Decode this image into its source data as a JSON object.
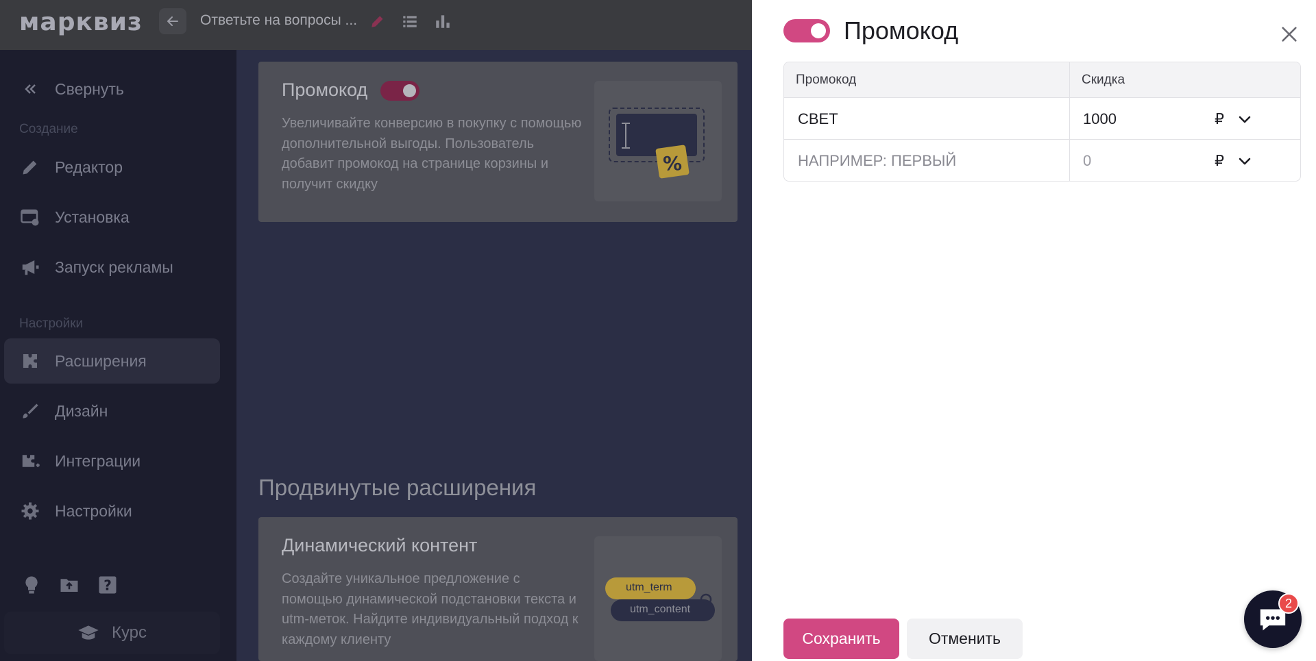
{
  "topbar": {
    "logo": "марквиз",
    "quiz_title": "Ответьте на вопросы ..."
  },
  "sidebar": {
    "collapse_label": "Свернуть",
    "section_create": "Создание",
    "section_settings": "Настройки",
    "items": [
      {
        "label": "Редактор",
        "icon": "pencil-icon"
      },
      {
        "label": "Установка",
        "icon": "install-icon"
      },
      {
        "label": "Запуск рекламы",
        "icon": "megaphone-icon"
      },
      {
        "label": "Расширения",
        "icon": "puzzle-icon",
        "active": true
      },
      {
        "label": "Дизайн",
        "icon": "brush-icon"
      },
      {
        "label": "Интеграции",
        "icon": "integrations-icon"
      },
      {
        "label": "Настройки",
        "icon": "gear-icon"
      }
    ],
    "course_label": "Курс"
  },
  "main": {
    "promo_card": {
      "title": "Промокод",
      "description": "Увеличивайте конверсию в покупку с помощью дополнительной выгоды. Пользователь добавит промокод на странице корзины и получит скидку",
      "enabled": true
    },
    "advanced_heading": "Продвинутые расширения",
    "dynamic_card": {
      "title": "Динамический контент",
      "description": "Создайте уникальное предложение с помощью динамической подстановки текста и utm-меток. Найдите индивидуальный подход к каждому клиенту",
      "tag1": "utm_term",
      "tag2": "utm_content"
    }
  },
  "panel": {
    "title": "Промокод",
    "enabled": true,
    "table": {
      "col_code": "Промокод",
      "col_discount": "Скидка",
      "rows": [
        {
          "code": "СВЕТ",
          "amount": "1000",
          "currency": "₽"
        }
      ],
      "new_row": {
        "code_placeholder": "НАПРИМЕР: ПЕРВЫЙ",
        "amount_placeholder": "0",
        "currency": "₽"
      }
    },
    "save_label": "Сохранить",
    "cancel_label": "Отменить"
  },
  "chat": {
    "badge": "2"
  },
  "colors": {
    "accent": "#d14882",
    "sidebar": "#1c1d2d"
  }
}
